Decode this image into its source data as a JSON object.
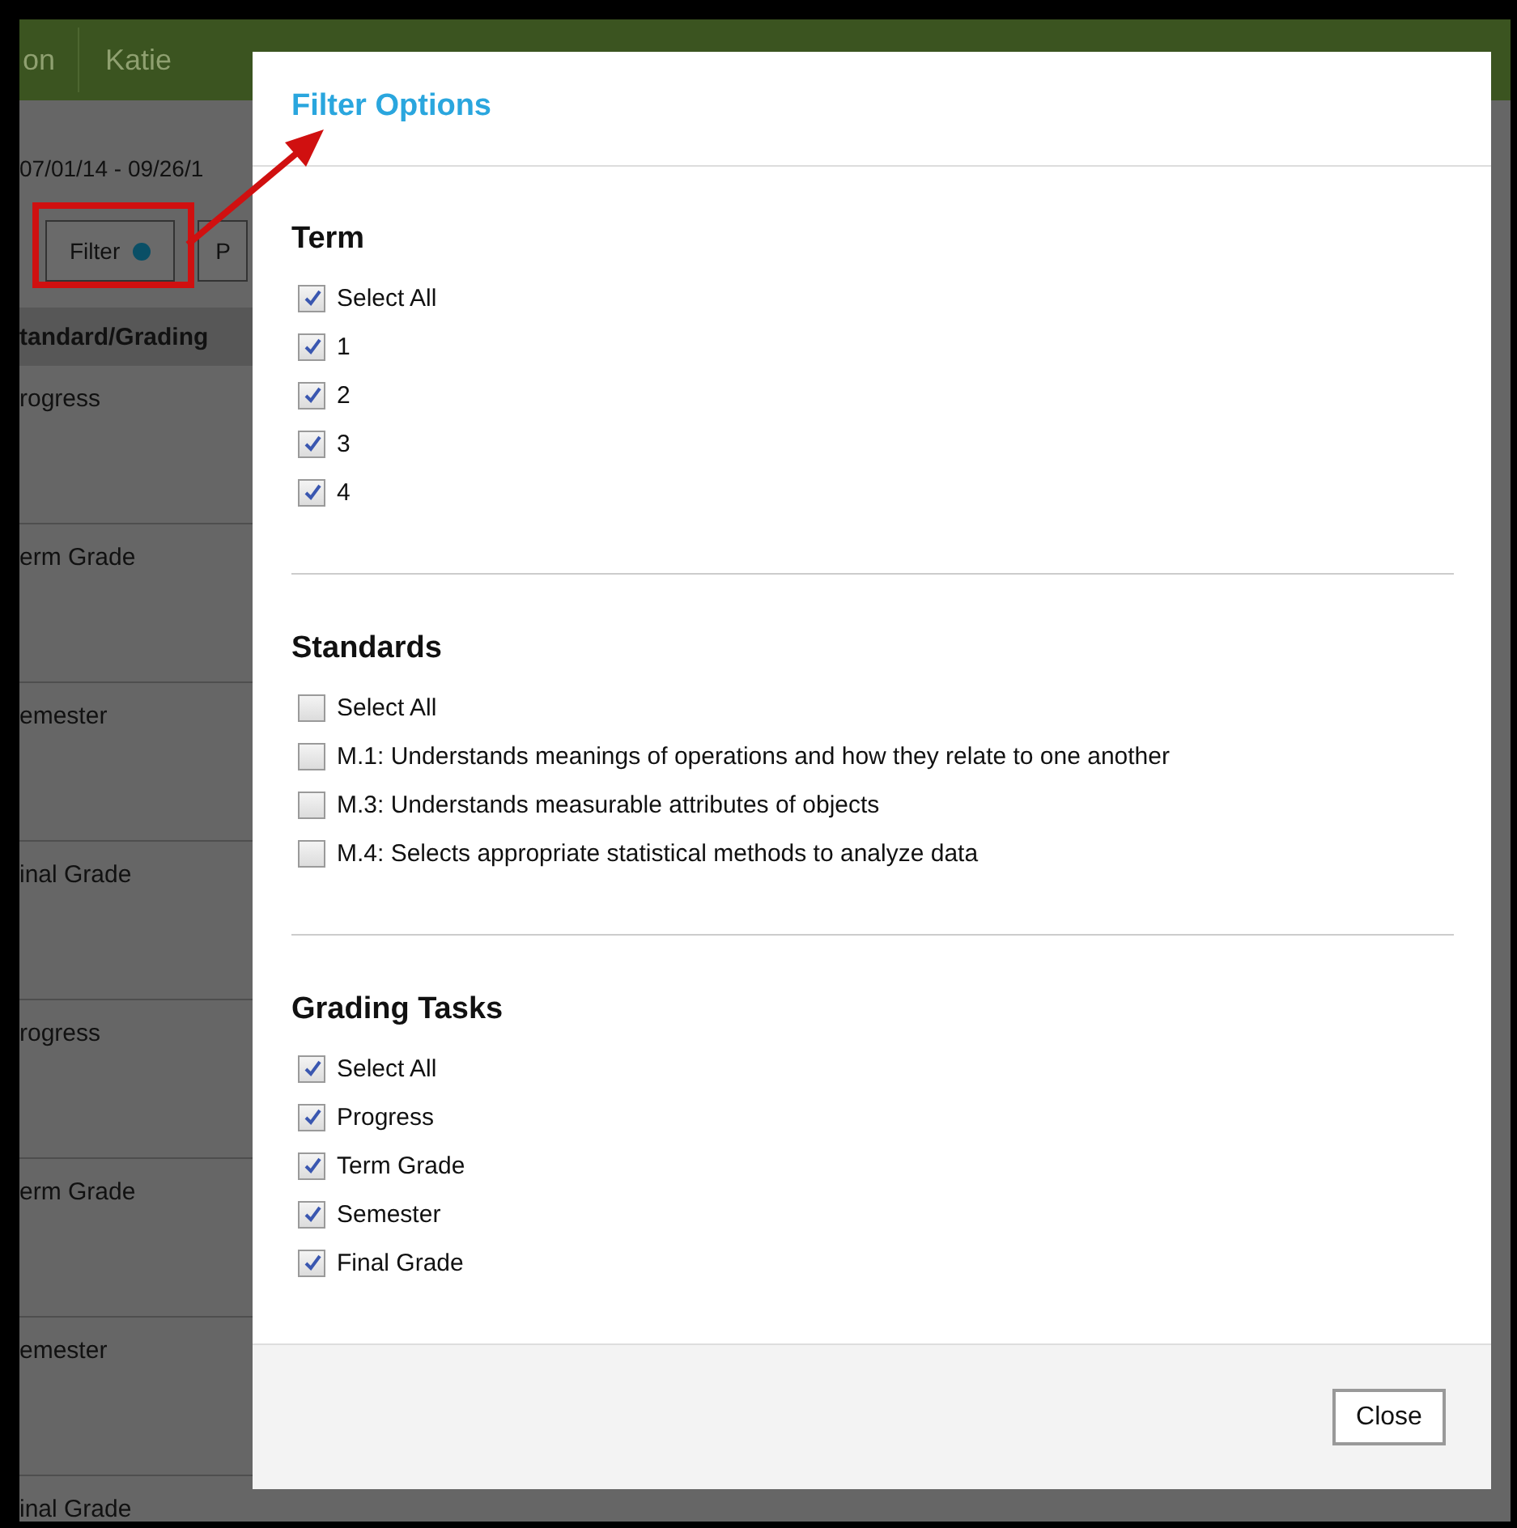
{
  "background": {
    "nav_items": [
      "on",
      "Katie"
    ],
    "date_range": "07/01/14 - 09/26/1",
    "filter_button": {
      "label": "Filter",
      "indicator": true
    },
    "second_button": "P",
    "table": {
      "header": "tandard/Grading",
      "rows": [
        "rogress",
        "erm Grade",
        "emester",
        "inal Grade",
        "rogress",
        "erm Grade",
        "emester",
        "inal Grade"
      ]
    }
  },
  "dialog": {
    "title": "Filter Options",
    "sections": [
      {
        "heading": "Term",
        "options": [
          {
            "label": "Select All",
            "checked": true
          },
          {
            "label": "1",
            "checked": true
          },
          {
            "label": "2",
            "checked": true
          },
          {
            "label": "3",
            "checked": true
          },
          {
            "label": "4",
            "checked": true
          }
        ]
      },
      {
        "heading": "Standards",
        "options": [
          {
            "label": "Select All",
            "checked": false
          },
          {
            "label": "M.1: Understands meanings of operations and how they relate to one another",
            "checked": false
          },
          {
            "label": "M.3: Understands measurable attributes of objects",
            "checked": false
          },
          {
            "label": "M.4: Selects appropriate statistical methods to analyze data",
            "checked": false
          }
        ]
      },
      {
        "heading": "Grading Tasks",
        "options": [
          {
            "label": "Select All",
            "checked": true
          },
          {
            "label": "Progress",
            "checked": true
          },
          {
            "label": "Term Grade",
            "checked": true
          },
          {
            "label": "Semester",
            "checked": true
          },
          {
            "label": "Final Grade",
            "checked": true
          }
        ]
      }
    ],
    "buttons": [
      "Close"
    ]
  }
}
